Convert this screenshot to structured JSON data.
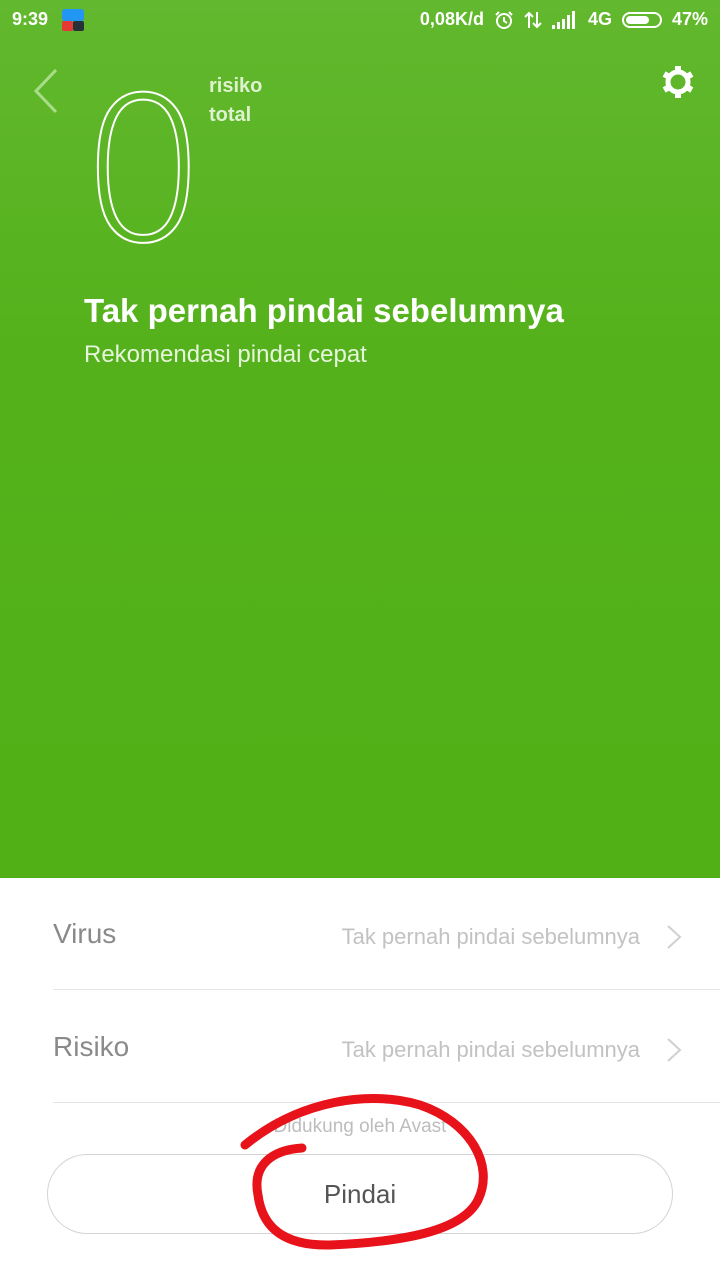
{
  "status_bar": {
    "time": "9:39",
    "network_speed": "0,08K/d",
    "network_type": "4G",
    "battery_percent": "47%",
    "battery_level": 0.47,
    "icons": [
      "app-notification-icon",
      "alarm-icon",
      "data-transfer-icon",
      "signal-icon",
      "battery-icon"
    ]
  },
  "header": {
    "back_icon": "chevron-left-icon",
    "settings_icon": "gear-icon"
  },
  "summary": {
    "risk_count": "0",
    "risk_label_line1": "risiko",
    "risk_label_line2": "total",
    "title": "Tak pernah pindai sebelumnya",
    "subtitle": "Rekomendasi pindai cepat"
  },
  "rows": [
    {
      "label": "Virus",
      "status": "Tak pernah pindai sebelumnya"
    },
    {
      "label": "Risiko",
      "status": "Tak pernah pindai sebelumnya"
    }
  ],
  "footer": {
    "powered_by": "Didukung oleh Avast",
    "scan_label": "Pindai"
  },
  "colors": {
    "hero_green": "#54b11b",
    "annotation_red": "#e8131a"
  }
}
